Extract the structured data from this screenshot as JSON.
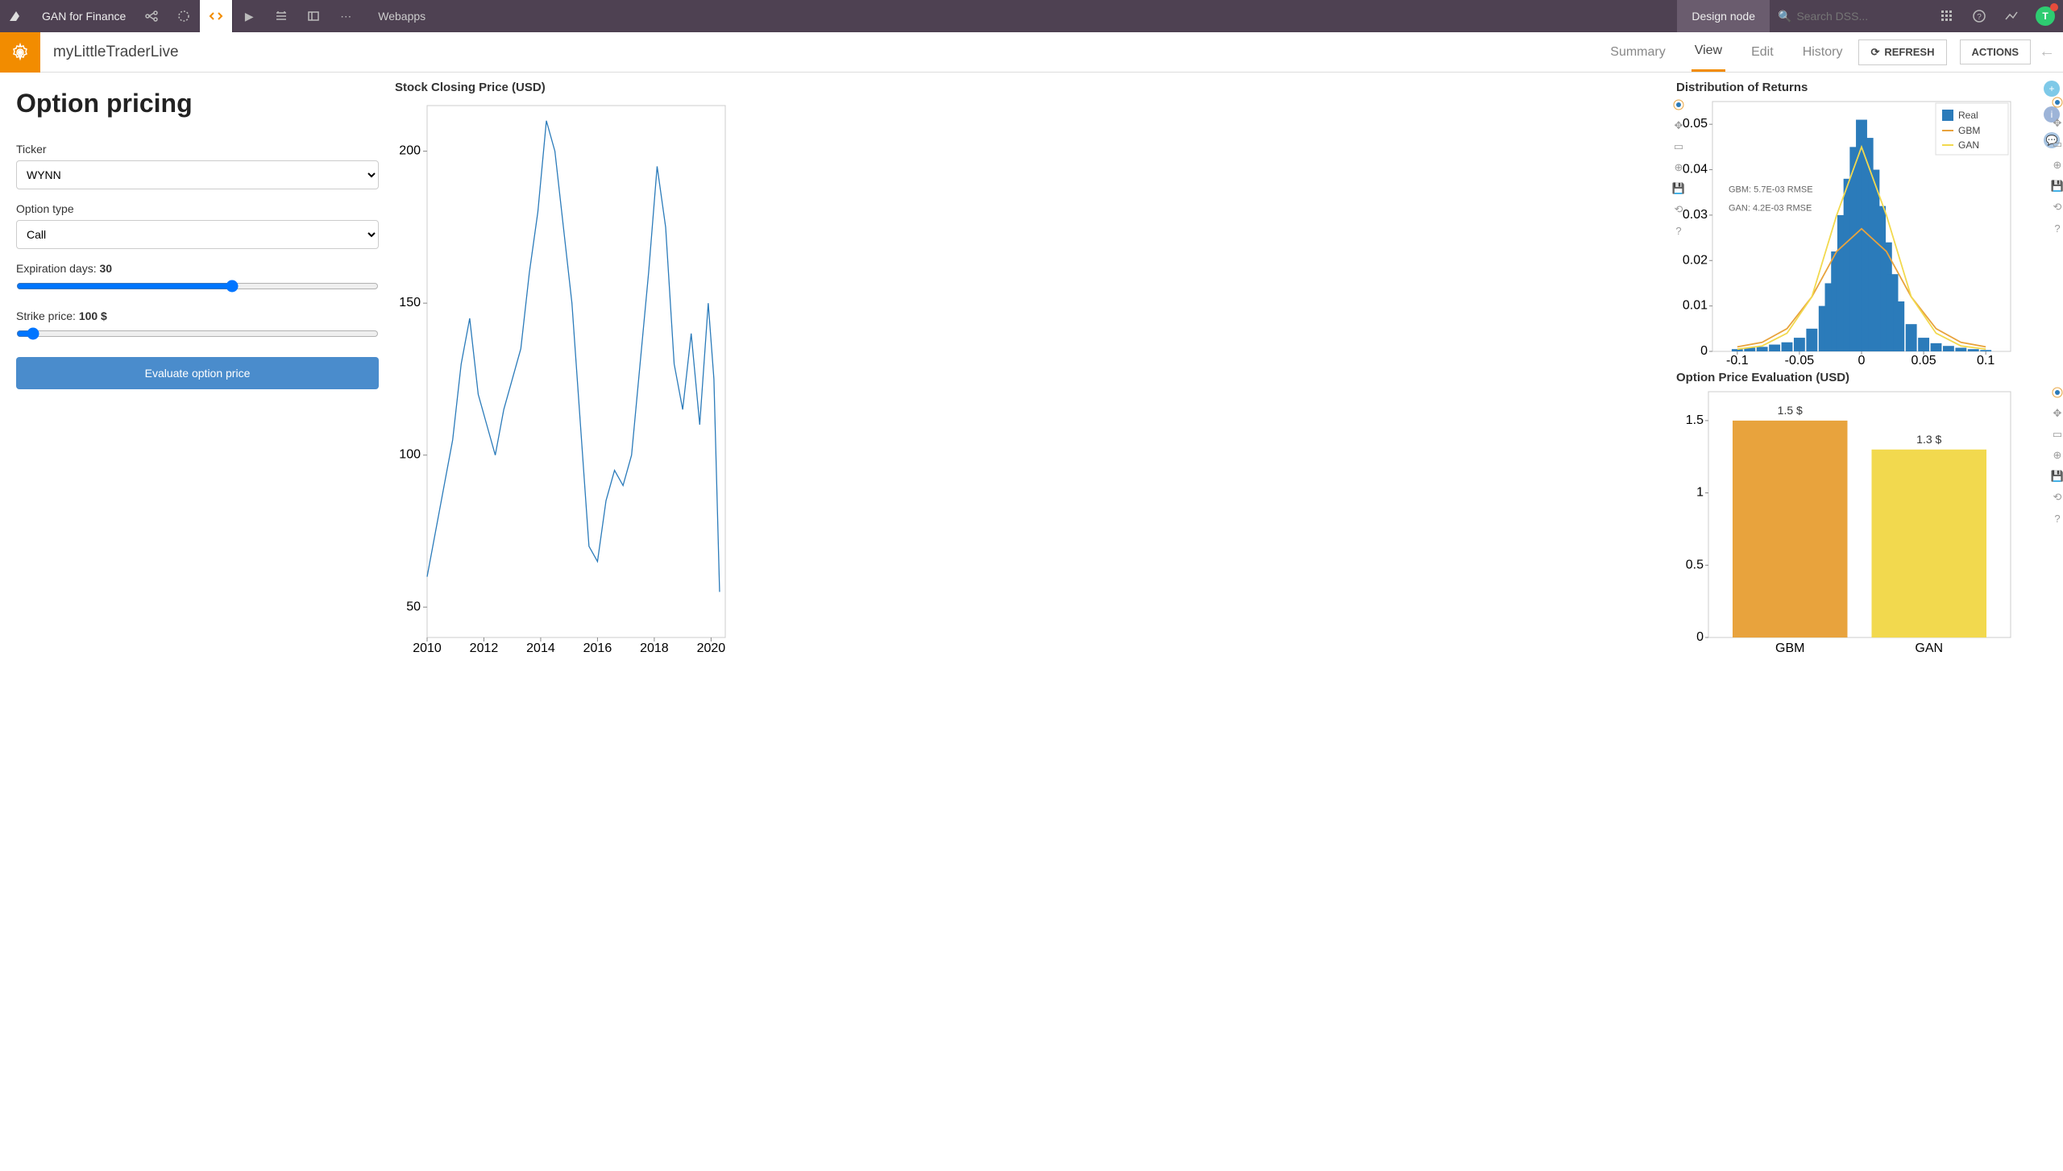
{
  "topbar": {
    "project": "GAN for Finance",
    "tab": "Webapps",
    "design_node": "Design node",
    "search_placeholder": "Search DSS...",
    "avatar_letter": "T"
  },
  "subheader": {
    "title": "myLittleTraderLive",
    "tabs": {
      "summary": "Summary",
      "view": "View",
      "edit": "Edit",
      "history": "History"
    },
    "refresh": "REFRESH",
    "actions": "ACTIONS"
  },
  "form": {
    "heading": "Option pricing",
    "ticker_label": "Ticker",
    "ticker_value": "WYNN",
    "option_type_label": "Option type",
    "option_type_value": "Call",
    "exp_label": "Expiration days: ",
    "exp_value": "30",
    "strike_label": "Strike price: ",
    "strike_value": "100 $",
    "button": "Evaluate option price"
  },
  "charts": {
    "stock_title": "Stock Closing Price (USD)",
    "dist_title": "Distribution of Returns",
    "eval_title": "Option Price Evaluation (USD)",
    "legend": {
      "real": "Real",
      "gbm": "GBM",
      "gan": "GAN"
    },
    "annot_gbm": "GBM: 5.7E-03 RMSE",
    "annot_gan": "GAN: 4.2E-03 RMSE"
  },
  "chart_data": [
    {
      "type": "line",
      "title": "Stock Closing Price (USD)",
      "xlabel": "",
      "ylabel": "",
      "xlim": [
        2010,
        2020.5
      ],
      "ylim": [
        40,
        215
      ],
      "x_ticks": [
        2010,
        2012,
        2014,
        2016,
        2018,
        2020
      ],
      "y_ticks": [
        50,
        100,
        150,
        200
      ],
      "series": [
        {
          "name": "WYNN",
          "x": [
            2010.0,
            2010.3,
            2010.6,
            2010.9,
            2011.2,
            2011.5,
            2011.8,
            2012.1,
            2012.4,
            2012.7,
            2013.0,
            2013.3,
            2013.6,
            2013.9,
            2014.2,
            2014.5,
            2014.8,
            2015.1,
            2015.4,
            2015.7,
            2016.0,
            2016.3,
            2016.6,
            2016.9,
            2017.2,
            2017.5,
            2017.8,
            2018.1,
            2018.4,
            2018.7,
            2019.0,
            2019.3,
            2019.6,
            2019.9,
            2020.1,
            2020.3
          ],
          "values": [
            60,
            75,
            90,
            105,
            130,
            145,
            120,
            110,
            100,
            115,
            125,
            135,
            160,
            180,
            210,
            200,
            175,
            150,
            110,
            70,
            65,
            85,
            95,
            90,
            100,
            130,
            160,
            195,
            175,
            130,
            115,
            140,
            110,
            150,
            125,
            55
          ]
        }
      ]
    },
    {
      "type": "bar",
      "title": "Distribution of Returns",
      "xlim": [
        -0.12,
        0.12
      ],
      "ylim": [
        0,
        0.055
      ],
      "x_ticks": [
        -0.1,
        -0.05,
        0,
        0.05,
        0.1
      ],
      "y_ticks": [
        0,
        0.01,
        0.02,
        0.03,
        0.04,
        0.05
      ],
      "categories": [
        -0.1,
        -0.09,
        -0.08,
        -0.07,
        -0.06,
        -0.05,
        -0.04,
        -0.03,
        -0.025,
        -0.02,
        -0.015,
        -0.01,
        -0.005,
        0.0,
        0.005,
        0.01,
        0.015,
        0.02,
        0.025,
        0.03,
        0.04,
        0.05,
        0.06,
        0.07,
        0.08,
        0.09,
        0.1
      ],
      "values": [
        0.0005,
        0.0008,
        0.001,
        0.0015,
        0.002,
        0.003,
        0.005,
        0.01,
        0.015,
        0.022,
        0.03,
        0.038,
        0.045,
        0.051,
        0.047,
        0.04,
        0.032,
        0.024,
        0.017,
        0.011,
        0.006,
        0.003,
        0.0018,
        0.0012,
        0.0008,
        0.0005,
        0.0003
      ],
      "overlays": [
        {
          "name": "GBM",
          "type": "line",
          "x": [
            -0.1,
            -0.08,
            -0.06,
            -0.04,
            -0.02,
            0.0,
            0.02,
            0.04,
            0.06,
            0.08,
            0.1
          ],
          "values": [
            0.001,
            0.002,
            0.005,
            0.012,
            0.022,
            0.027,
            0.022,
            0.012,
            0.005,
            0.002,
            0.001
          ]
        },
        {
          "name": "GAN",
          "type": "line",
          "x": [
            -0.1,
            -0.08,
            -0.06,
            -0.04,
            -0.02,
            0.0,
            0.02,
            0.04,
            0.06,
            0.08,
            0.1
          ],
          "values": [
            0.0005,
            0.0012,
            0.004,
            0.012,
            0.03,
            0.045,
            0.03,
            0.012,
            0.004,
            0.0012,
            0.0005
          ]
        }
      ],
      "annotations": [
        "GBM: 5.7E-03 RMSE",
        "GAN: 4.2E-03 RMSE"
      ]
    },
    {
      "type": "bar",
      "title": "Option Price Evaluation (USD)",
      "categories": [
        "GBM",
        "GAN"
      ],
      "values": [
        1.5,
        1.3
      ],
      "labels": [
        "1.5 $",
        "1.3 $"
      ],
      "ylim": [
        0,
        1.7
      ],
      "y_ticks": [
        0,
        0.5,
        1,
        1.5
      ]
    }
  ]
}
